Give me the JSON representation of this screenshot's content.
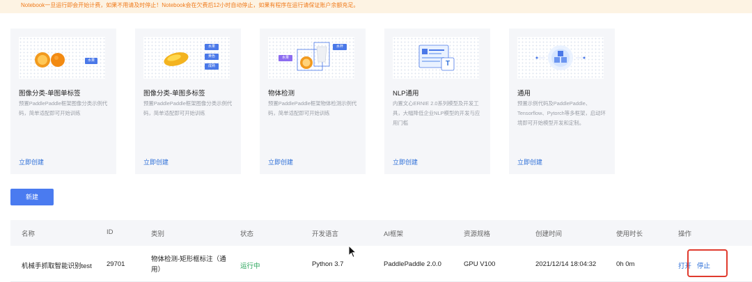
{
  "notice": {
    "text": "Notebook一旦运行即会开始计费，如果不用请及时停止！Notebook会在欠费后12小时自动停止，如果有程序在运行请保证账户余额充足。"
  },
  "templates": [
    {
      "title": "图像分类-单图单标签",
      "desc": "预置PaddlePaddle框架图像分类示例代码，简单适配即可开始训练",
      "action": "立即创建",
      "tags": [
        "水果"
      ]
    },
    {
      "title": "图像分类-单图多标签",
      "desc": "预置PaddlePaddle框架图像分类示例代码，简单适配即可开始训练",
      "action": "立即创建",
      "tags": [
        "水果",
        "黄色",
        "成熟"
      ]
    },
    {
      "title": "物体检测",
      "desc": "预置PaddlePaddle框架物体检测示例代码，简单适配即可开始训练",
      "action": "立即创建",
      "tags": [
        "水果",
        "水杯"
      ]
    },
    {
      "title": "NLP通用",
      "desc": "内置文心ERNIE 2.0系列模型及开发工具，大幅降低企业NLP模型的开发与应用门槛",
      "action": "立即创建",
      "tags": [
        "T"
      ]
    },
    {
      "title": "通用",
      "desc": "预置示例代码及PaddlePaddle、Tensorflow、Pytorch等多框架，启动环境即可开始模型开发和定制。",
      "action": "立即创建",
      "tags": []
    }
  ],
  "new_button": "新建",
  "table": {
    "headers": [
      "名称",
      "ID",
      "类别",
      "状态",
      "开发语言",
      "AI框架",
      "资源规格",
      "创建时间",
      "使用时长",
      "操作"
    ],
    "row": {
      "name": "机械手抓取智能识别test",
      "id": "29701",
      "category": "物体检测-矩形框标注（通用）",
      "status": "运行中",
      "language": "Python 3.7",
      "framework": "PaddlePaddle 2.0.0",
      "resource": "GPU V100",
      "created": "2021/12/14 18:04:32",
      "duration": "0h 0m",
      "open": "打开",
      "stop": "停止"
    }
  },
  "colors": {
    "accent": "#4a7bf0",
    "link": "#2d6fd8",
    "running": "#2aa55b",
    "warning_bg": "#fdf3e3",
    "warning_text": "#f07a1a",
    "highlight": "#e03a2d"
  }
}
